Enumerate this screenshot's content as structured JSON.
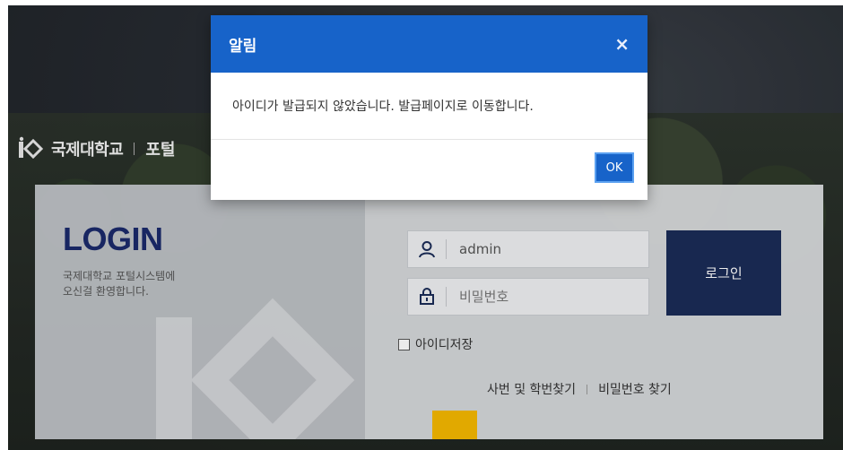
{
  "brand": {
    "name": "국제대학교",
    "portal": "포털"
  },
  "login": {
    "title": "LOGIN",
    "welcome_line1": "국제대학교 포털시스템에",
    "welcome_line2": "오신걸 환영합니다.",
    "id_value": "admin",
    "password_placeholder": "비밀번호",
    "login_button": "로그인",
    "remember_label": "아이디저장",
    "find_id_link": "사번 및 학번찾기",
    "find_password_link": "비밀번호 찾기"
  },
  "modal": {
    "title": "알림",
    "close": "×",
    "message": "아이디가 발급되지 않았습니다. 발급페이지로 이동합니다.",
    "ok_label": "OK"
  },
  "colors": {
    "modal_header": "#1763c9",
    "login_button": "#1b2c57",
    "login_title": "#1b2a6b",
    "accent_yellow": "#f5b800"
  },
  "icons": {
    "user": "user-icon",
    "lock": "lock-icon",
    "close": "close-icon"
  }
}
